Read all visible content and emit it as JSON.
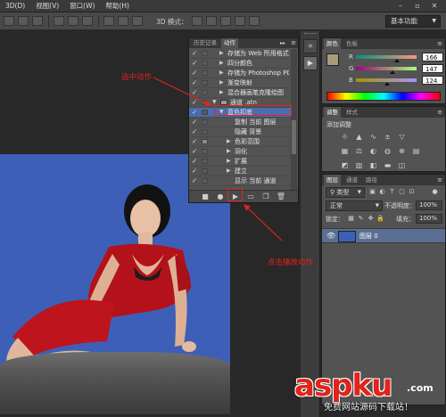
{
  "menubar": {
    "items": [
      "3D(D)",
      "视图(V)",
      "窗口(W)",
      "帮助(H)"
    ],
    "window_controls": [
      "minimize-icon",
      "restore-icon",
      "close-icon"
    ]
  },
  "options_bar": {
    "mode_label": "3D 模式：",
    "workspace": "基本功能"
  },
  "actions_panel": {
    "tabs": [
      "历史记录",
      "动作"
    ],
    "active_tab": "动作",
    "rows": [
      {
        "checked": true,
        "dialog": false,
        "expanded": false,
        "indent": 1,
        "label": "存储为 Web 所用格式（自选）"
      },
      {
        "checked": true,
        "dialog": false,
        "expanded": false,
        "indent": 1,
        "label": "四分颜色"
      },
      {
        "checked": true,
        "dialog": false,
        "expanded": false,
        "indent": 1,
        "label": "存储为 Photoshop PDF"
      },
      {
        "checked": true,
        "dialog": false,
        "expanded": false,
        "indent": 1,
        "label": "渐变映射"
      },
      {
        "checked": true,
        "dialog": false,
        "expanded": false,
        "indent": 1,
        "label": "混合器画笔克隆绘图"
      },
      {
        "checked": true,
        "dialog": false,
        "expanded": true,
        "indent": 0,
        "label": "通道 .atn",
        "is_set": true
      },
      {
        "checked": true,
        "dialog": false,
        "expanded": true,
        "indent": 1,
        "label": "蓝色扣底",
        "selected": true
      },
      {
        "checked": true,
        "dialog": false,
        "expanded": false,
        "indent": 2,
        "label": "复制 当前 图层"
      },
      {
        "checked": true,
        "dialog": false,
        "expanded": false,
        "indent": 2,
        "label": "隐藏 背景"
      },
      {
        "checked": true,
        "dialog": true,
        "expanded": false,
        "indent": 2,
        "label": "色彩范围",
        "has_arrow": true
      },
      {
        "checked": true,
        "dialog": false,
        "expanded": false,
        "indent": 2,
        "label": "羽化",
        "has_arrow": true
      },
      {
        "checked": true,
        "dialog": false,
        "expanded": false,
        "indent": 2,
        "label": "扩展",
        "has_arrow": true
      },
      {
        "checked": true,
        "dialog": false,
        "expanded": false,
        "indent": 2,
        "label": "建立",
        "has_arrow": true
      },
      {
        "checked": true,
        "dialog": false,
        "expanded": false,
        "indent": 2,
        "label": "显示 当前 通道"
      }
    ],
    "bottom_buttons": [
      "stop-icon",
      "record-icon",
      "play-icon",
      "new-set-icon",
      "new-action-icon",
      "delete-icon"
    ]
  },
  "color_panel": {
    "tabs": [
      "颜色",
      "色板"
    ],
    "channels": [
      {
        "name": "R",
        "value": "166"
      },
      {
        "name": "G",
        "value": "147"
      },
      {
        "name": "B",
        "value": "124"
      }
    ],
    "foreground": "#a6937c"
  },
  "adjustments_panel": {
    "tabs": [
      "调整",
      "样式"
    ],
    "label": "添加调整"
  },
  "layers_panel": {
    "tabs": [
      "图层",
      "通道",
      "路径"
    ],
    "filter_label": "类型",
    "blend_mode": "正常",
    "opacity_label": "不透明度：",
    "opacity": "100%",
    "lock_label": "锁定：",
    "fill_label": "填充：",
    "fill": "100%",
    "layer_name": "图层 0"
  },
  "annotations": {
    "select_action": "选中动作",
    "click_play": "点击播放动作"
  },
  "watermark": {
    "main": "aspku",
    "suffix": ".com",
    "sub": "免费网站源码下载站！"
  }
}
